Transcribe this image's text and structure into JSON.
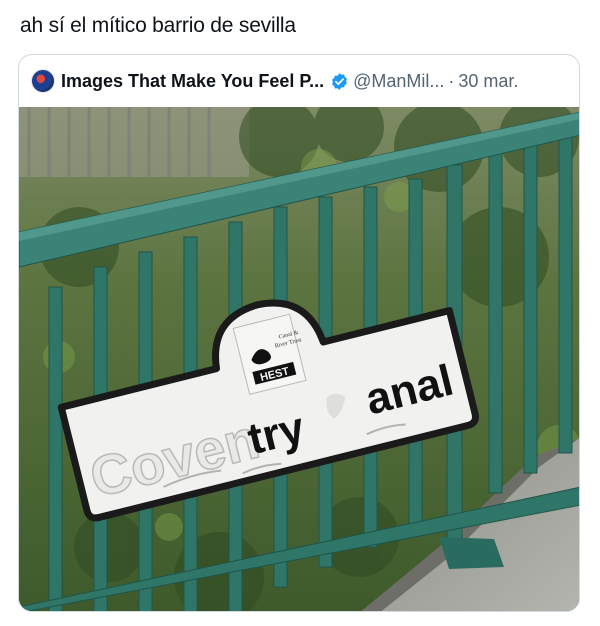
{
  "tweet": {
    "caption": "ah sí el mítico barrio de sevilla"
  },
  "quoted": {
    "name": "Images That Make You Feel P...",
    "handle": "@ManMil...",
    "separator": "·",
    "date": "30 mar.",
    "avatar_icon": "globe-avatar-icon",
    "verified_icon": "verified-badge-icon"
  },
  "photo": {
    "sign": {
      "text_faded": "Coven",
      "text_middle": "try",
      "text_right": "anal",
      "logo_line1": "Canal &",
      "logo_line2": "River Trust",
      "logo_label": "HEST"
    }
  },
  "colors": {
    "verified_blue": "#1d9bf0",
    "railing_green": "#2f7669",
    "sign_white": "#f1f1ef",
    "sign_border": "#1a1a1a"
  }
}
